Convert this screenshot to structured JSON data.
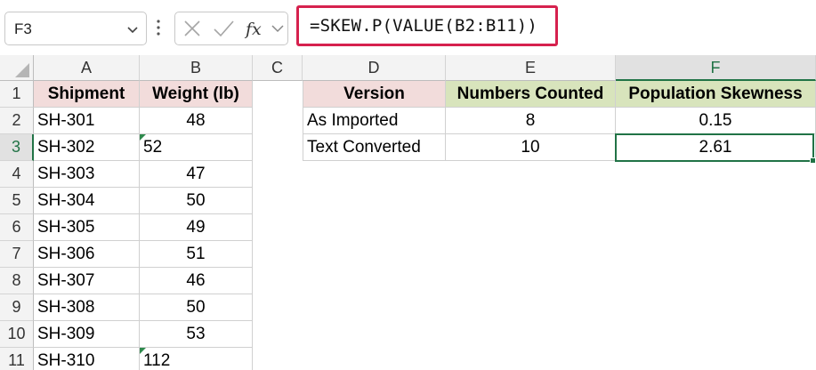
{
  "formula_bar": {
    "name_box": "F3",
    "formula": "=SKEW.P(VALUE(B2:B11))",
    "highlight_color": "#d6214e"
  },
  "icons": {
    "cancel": "x-icon",
    "enter": "check-icon",
    "insert_function": "fx-icon",
    "expand": "chevron-down-icon"
  },
  "columns": [
    "A",
    "B",
    "C",
    "D",
    "E",
    "F"
  ],
  "rows": [
    "1",
    "2",
    "3",
    "4",
    "5",
    "6",
    "7",
    "8",
    "9",
    "10",
    "11"
  ],
  "table1": {
    "headers": [
      "Shipment",
      "Weight (lb)"
    ],
    "rows": [
      {
        "shipment": "SH-301",
        "weight": "48"
      },
      {
        "shipment": "SH-302",
        "weight": "52"
      },
      {
        "shipment": "SH-303",
        "weight": "47"
      },
      {
        "shipment": "SH-304",
        "weight": "50"
      },
      {
        "shipment": "SH-305",
        "weight": "49"
      },
      {
        "shipment": "SH-306",
        "weight": "51"
      },
      {
        "shipment": "SH-307",
        "weight": "46"
      },
      {
        "shipment": "SH-308",
        "weight": "50"
      },
      {
        "shipment": "SH-309",
        "weight": "53"
      },
      {
        "shipment": "SH-310",
        "weight": "112"
      }
    ]
  },
  "table2": {
    "headers": [
      "Version",
      "Numbers Counted",
      "Population Skewness"
    ],
    "rows": [
      {
        "version": "As Imported",
        "count": "8",
        "skew": "0.15"
      },
      {
        "version": "Text Converted",
        "count": "10",
        "skew": "2.61"
      }
    ]
  },
  "colors": {
    "pink_header": "#f2dcdb",
    "green_header": "#d8e4bc",
    "selection": "#217346"
  }
}
